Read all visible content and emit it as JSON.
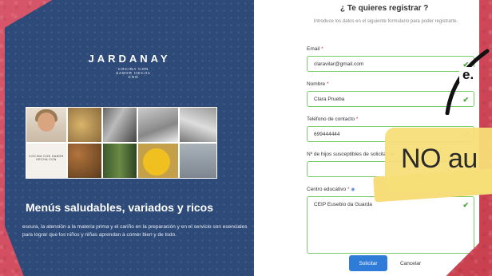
{
  "brand": {
    "name": "JARDANAY",
    "tagline": "COCINA CON SABOR HECHA CON"
  },
  "collage": {
    "card_text": "COCINA CON SABOR HECHA CON"
  },
  "left": {
    "headline": "Menús saludables, variados y ricos",
    "body": "escura, la atención a la materia prima y el cariño en la preparación y en el servicio son esenciales para lograr que los niños y niñas aprendan a comer bien y de todo."
  },
  "form": {
    "title": "¿ Te quieres registrar ?",
    "subtitle": "Introduce los datos en el siguiente formulario para poder registrarte.",
    "email": {
      "label": "Email",
      "value": "claravilar@gmail.com"
    },
    "name": {
      "label": "Nombre",
      "value": "Clara Prueba"
    },
    "phone": {
      "label": "Teléfono de contacto",
      "value": "699444444"
    },
    "children": {
      "label": "Nº de hijos susceptibles de solicitar se",
      "value": ""
    },
    "school": {
      "label": "Centro educativo",
      "value": "CEIP Eusebio da Guarda"
    },
    "submit_label": "Solicitar",
    "cancel_label": "Cancelar"
  },
  "overlay": {
    "big_text": "NO au",
    "corner_text": "e."
  },
  "colors": {
    "background": "#d24a5c",
    "left_panel": "#2d4a78",
    "valid_border": "#7cc96a",
    "primary_button": "#2e7bd8",
    "overlay_yellow": "#f6dd7a"
  }
}
